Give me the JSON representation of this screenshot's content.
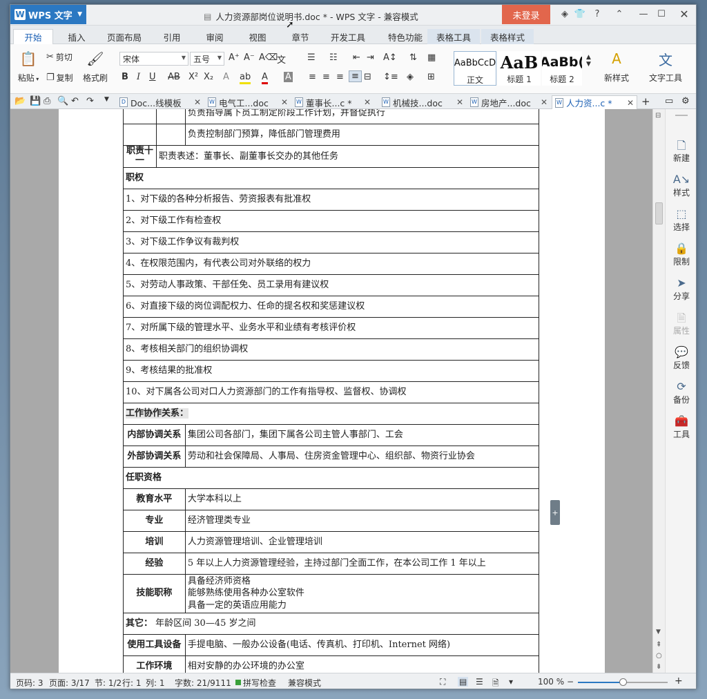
{
  "app": {
    "name": "WPS 文字",
    "login": "未登录"
  },
  "window": {
    "title": "人力资源部岗位说明书.doc * - WPS 文字 - 兼容模式"
  },
  "ribbon_tabs": [
    {
      "label": "开始",
      "active": true
    },
    {
      "label": "插入"
    },
    {
      "label": "页面布局"
    },
    {
      "label": "引用"
    },
    {
      "label": "审阅"
    },
    {
      "label": "视图"
    },
    {
      "label": "章节"
    },
    {
      "label": "开发工具"
    },
    {
      "label": "特色功能"
    },
    {
      "label": "表格工具",
      "context": true
    },
    {
      "label": "表格样式",
      "context": true
    }
  ],
  "ribbon": {
    "paste": "粘贴",
    "cut": "剪切",
    "copy": "复制",
    "format_painter": "格式刷",
    "font": "宋体",
    "size": "五号",
    "styles": [
      {
        "sample": "AaBbCcD",
        "cap": "正文"
      },
      {
        "sample": "AaB",
        "cap": "标题 1"
      },
      {
        "sample": "AaBb(",
        "cap": "标题 2"
      }
    ],
    "new_style": "新样式",
    "text_tools": "文字工具"
  },
  "doc_tabs": [
    {
      "label": "Doc...线模板"
    },
    {
      "label": "电气工...doc"
    },
    {
      "label": "董事长...c *"
    },
    {
      "label": "机械技...doc"
    },
    {
      "label": "房地产...doc"
    },
    {
      "label": "人力资...c *",
      "active": true
    }
  ],
  "side_panel": [
    {
      "label": "新建",
      "icon": "new-doc-icon"
    },
    {
      "label": "样式",
      "icon": "style-icon"
    },
    {
      "label": "选择",
      "icon": "select-icon"
    },
    {
      "label": "限制",
      "icon": "restrict-icon"
    },
    {
      "label": "分享",
      "icon": "share-icon"
    },
    {
      "label": "属性",
      "icon": "properties-icon",
      "disabled": true
    },
    {
      "label": "反馈",
      "icon": "feedback-icon"
    },
    {
      "label": "备份",
      "icon": "backup-icon"
    },
    {
      "label": "工具",
      "icon": "toolbox-icon"
    }
  ],
  "document": {
    "duty_rows": [
      "负责指导属下员工制定阶段工作计划，并督促执行",
      "负责控制部门预算，降低部门管理费用"
    ],
    "duty11_label": "职责十一",
    "duty11_text": "职责表述：董事长、副董事长交办的其他任务",
    "authority_heading": "职权",
    "authority": [
      "1、对下级的各种分析报告、劳资报表有批准权",
      "2、对下级工作有检查权",
      "3、对下级工作争议有裁判权",
      "4、在权限范围内，有代表公司对外联络的权力",
      "5、对劳动人事政策、干部任免、员工录用有建议权",
      "6、对直接下级的岗位调配权力、任命的提名权和奖惩建议权",
      "7、对所属下级的管理水平、业务水平和业绩有考核评价权",
      "8、考核相关部门的组织协调权",
      "9、考核结果的批准权",
      "10、对下属各公司对口人力资源部门的工作有指导权、监督权、协调权"
    ],
    "coop_heading": "工作协作关系：",
    "internal_label": "内部协调关系",
    "internal_text": "集团公司各部门，集团下属各公司主管人事部门、工会",
    "external_label": "外部协调关系",
    "external_text": "劳动和社会保障局、人事局、住房资金管理中心、组织部、物资行业协会",
    "qual_heading": "任职资格",
    "quals": [
      {
        "label": "教育水平",
        "text": "大学本科以上"
      },
      {
        "label": "专业",
        "text": "经济管理类专业"
      },
      {
        "label": "培训",
        "text": "人力资源管理培训、企业管理培训"
      },
      {
        "label": "经验",
        "text": "5 年以上人力资源管理经验，主持过部门全面工作，在本公司工作 1 年以上"
      }
    ],
    "skill_label": "技能职称",
    "skill_lines": [
      "具备经济师资格",
      "能够熟练使用各种办公室软件",
      "具备一定的英语应用能力"
    ],
    "other_label": "其它：",
    "other_text": "年龄区间 30—45 岁之间",
    "tools_label": "使用工具设备",
    "tools_text": "手提电脑、一般办公设备(电话、传真机、打印机、Internet 网络)",
    "env_label": "工作环境",
    "env_text": "相对安静的办公环境的办公室"
  },
  "status": {
    "page_code": "页码: 3",
    "pages": "页面: 3/17",
    "section": "节: 1/2",
    "row": "行: 1",
    "col": "列: 1",
    "words": "字数: 21/9111",
    "spell": "拼写检查",
    "compat": "兼容模式",
    "zoom": "100 %"
  }
}
